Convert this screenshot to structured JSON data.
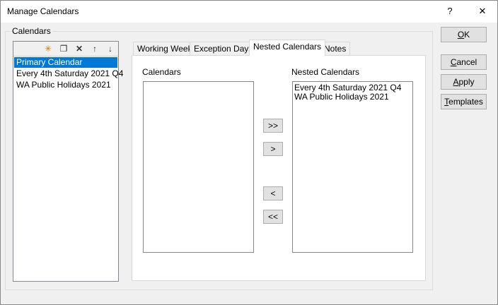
{
  "window": {
    "title": "Manage Calendars",
    "help": "?",
    "close": "✕"
  },
  "group_label": "Calendars",
  "toolbar": {
    "icons": [
      "new-icon",
      "copy-icon",
      "delete-icon",
      "move-up-icon",
      "move-down-icon"
    ],
    "glyphs": [
      "✳",
      "❐",
      "✕",
      "↑",
      "↓"
    ]
  },
  "calendars": [
    "Primary Calendar",
    "Every 4th Saturday 2021 Q4",
    "WA Public Holidays 2021"
  ],
  "selected_calendar": "Primary Calendar",
  "tabs": [
    "Working Week",
    "Exception Days",
    "Nested Calendars",
    "Notes"
  ],
  "active_tab": "Nested Calendars",
  "nested": {
    "available_label": "Calendars",
    "available": [],
    "nested_label": "Nested Calendars",
    "nested_items": [
      "Every 4th Saturday 2021 Q4",
      "WA Public Holidays 2021"
    ],
    "add_all": ">>",
    "add": ">",
    "remove": "<",
    "remove_all": "<<"
  },
  "buttons": {
    "ok": {
      "accel": "O",
      "rest": "K"
    },
    "cancel": {
      "accel": "C",
      "rest": "ancel"
    },
    "apply": {
      "accel": "A",
      "rest": "pply"
    },
    "templates": {
      "accel": "T",
      "rest": "emplates"
    }
  }
}
